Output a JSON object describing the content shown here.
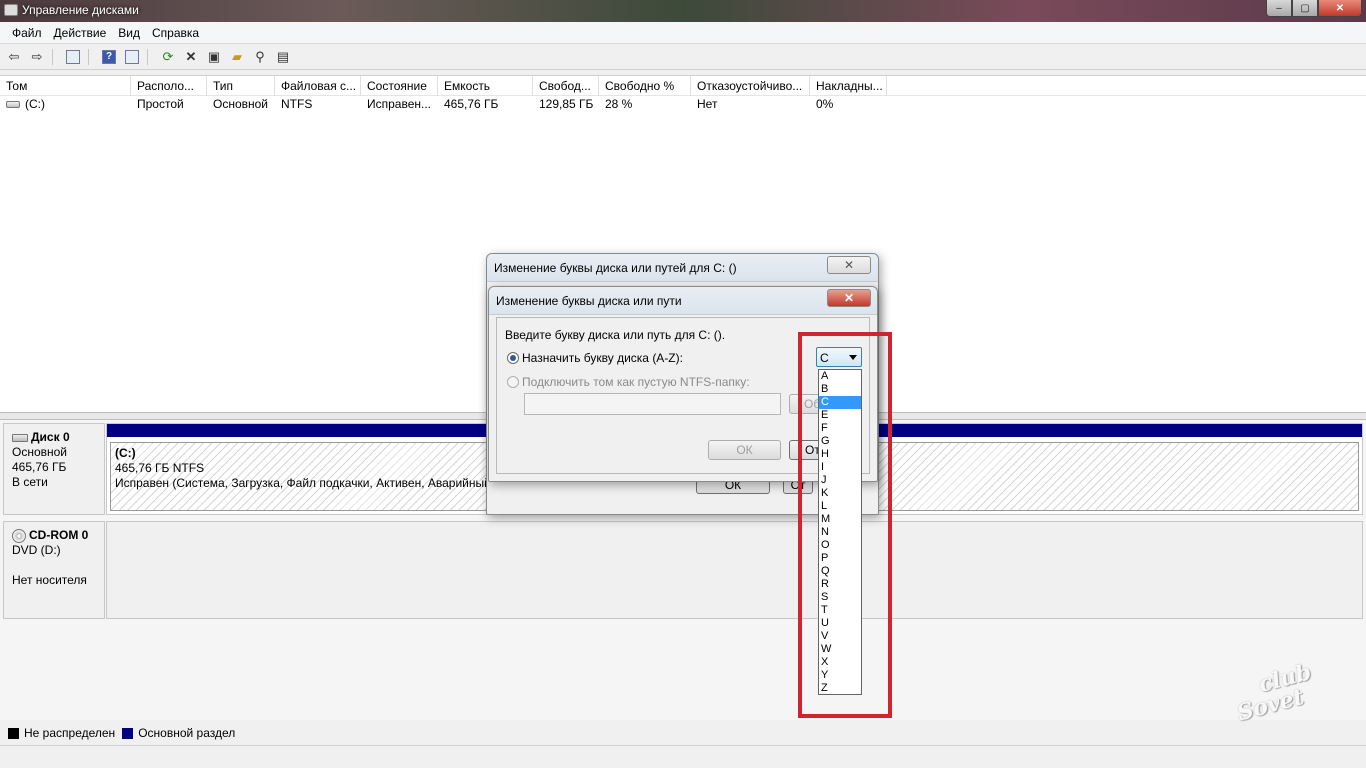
{
  "window": {
    "title": "Управление дисками",
    "controls": {
      "minimize": "–",
      "maximize": "▢",
      "close": "✕"
    }
  },
  "menu": [
    "Файл",
    "Действие",
    "Вид",
    "Справка"
  ],
  "toolbar": {
    "icons": [
      "back-icon",
      "forward-icon",
      "show-hide-console-tree-icon",
      "help-icon",
      "properties-icon",
      "refresh-icon",
      "delete-icon",
      "rescan-icon",
      "open-icon",
      "search-icon",
      "settings-icon"
    ]
  },
  "volume_list": {
    "columns": [
      "Том",
      "Располо...",
      "Тип",
      "Файловая с...",
      "Состояние",
      "Емкость",
      "Свобод...",
      "Свободно %",
      "Отказоустойчиво...",
      "Накладны..."
    ],
    "rows": [
      [
        "(C:)",
        "Простой",
        "Основной",
        "NTFS",
        "Исправен...",
        "465,76 ГБ",
        "129,85 ГБ",
        "28 %",
        "Нет",
        "0%"
      ]
    ]
  },
  "disks": [
    {
      "name": "Диск 0",
      "type": "Основной",
      "size": "465,76 ГБ",
      "status": "В сети",
      "partition": {
        "name": "(C:)",
        "size_fs": "465,76 ГБ NTFS",
        "status": "Исправен (Система, Загрузка, Файл подкачки, Активен, Аварийный"
      }
    },
    {
      "name": "CD-ROM 0",
      "type": "DVD (D:)",
      "size": "",
      "status": "Нет носителя"
    }
  ],
  "legend": [
    {
      "label": "Не распределен",
      "color": "#000000"
    },
    {
      "label": "Основной раздел",
      "color": "#000080"
    }
  ],
  "dialog_outer": {
    "title": "Изменение буквы диска или путей для C: ()",
    "close": "✕",
    "ok_partial": "ОК",
    "other_partial": "От"
  },
  "dialog_inner": {
    "title": "Изменение буквы диска или пути",
    "close": "✕",
    "prompt": "Введите букву диска или путь для C: ().",
    "assign_letter_label": "Назначить букву диска (A-Z):",
    "mount_folder_label": "Подключить том как пустую NTFS-папку:",
    "browse_partial": "Об",
    "ok": "ОК",
    "cancel_partial": "От",
    "selected_letter": "C"
  },
  "letters": [
    "A",
    "B",
    "C",
    "E",
    "F",
    "G",
    "H",
    "I",
    "J",
    "K",
    "L",
    "M",
    "N",
    "O",
    "P",
    "Q",
    "R",
    "S",
    "T",
    "U",
    "V",
    "W",
    "X",
    "Y",
    "Z"
  ],
  "watermark": {
    "line1": "club",
    "line2": "Sovet"
  }
}
